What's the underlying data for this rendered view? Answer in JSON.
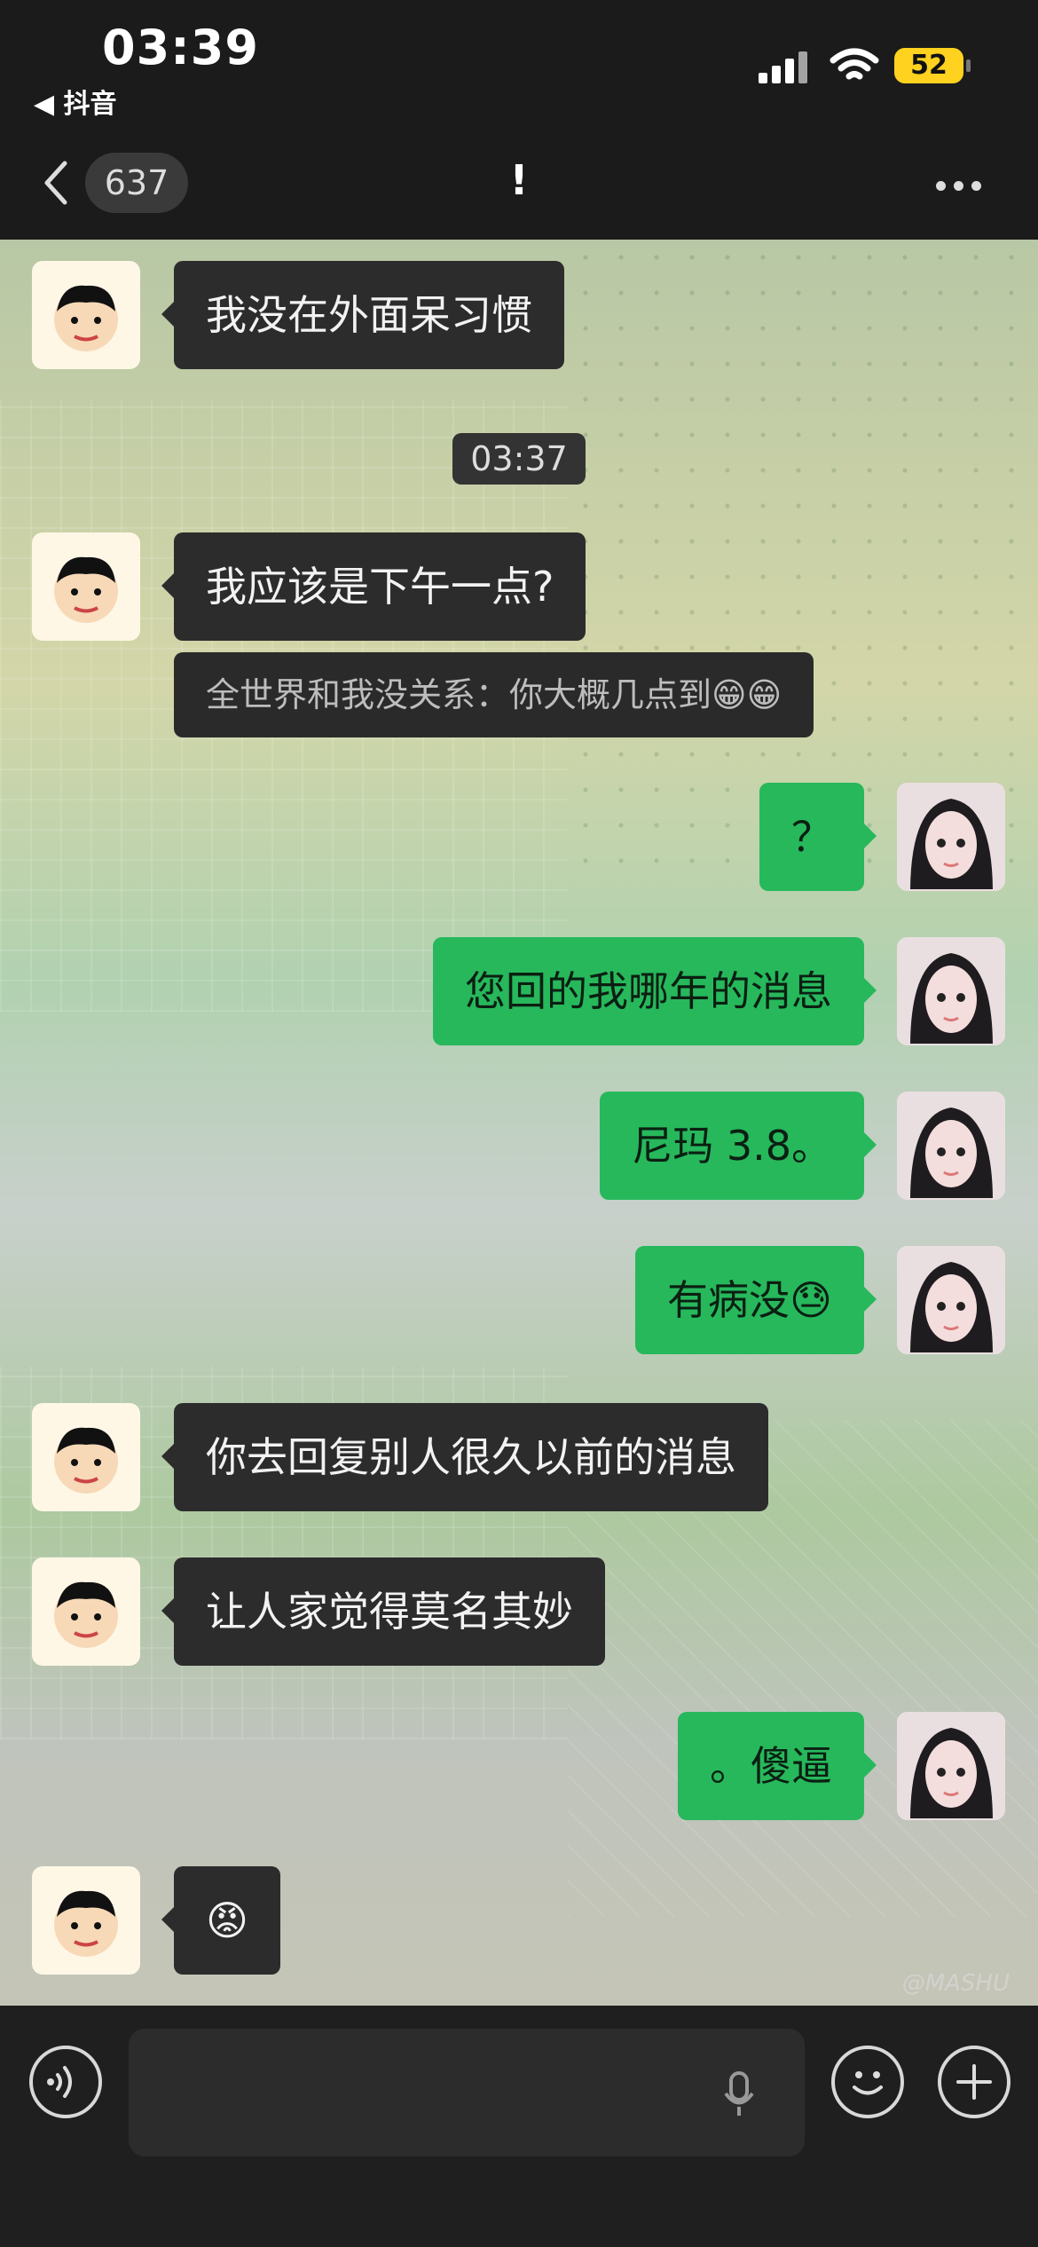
{
  "status": {
    "time": "03:39",
    "back_app": "◀ 抖音",
    "battery": "52"
  },
  "nav": {
    "unread_count": "637",
    "title": "!"
  },
  "messages": [
    {
      "text": "我没在外面呆习惯"
    },
    {
      "text": "03:37"
    },
    {
      "text": "我应该是下午一点?",
      "quote": "全世界和我没关系：你大概几点到😁😁"
    },
    {
      "text": "？"
    },
    {
      "text": "您回的我哪年的消息"
    },
    {
      "text": "尼玛 3.8。"
    },
    {
      "text": "有病没😓"
    },
    {
      "text": "你去回复别人很久以前的消息"
    },
    {
      "text": "让人家觉得莫名其妙"
    },
    {
      "text": "。傻逼"
    },
    {
      "text": "😡"
    }
  ],
  "background": {
    "watermark": "@MASHU"
  },
  "colors": {
    "outgoing": "#27b85c",
    "incoming": "#2c2c2c",
    "top_bar": "#1b1b1b"
  }
}
